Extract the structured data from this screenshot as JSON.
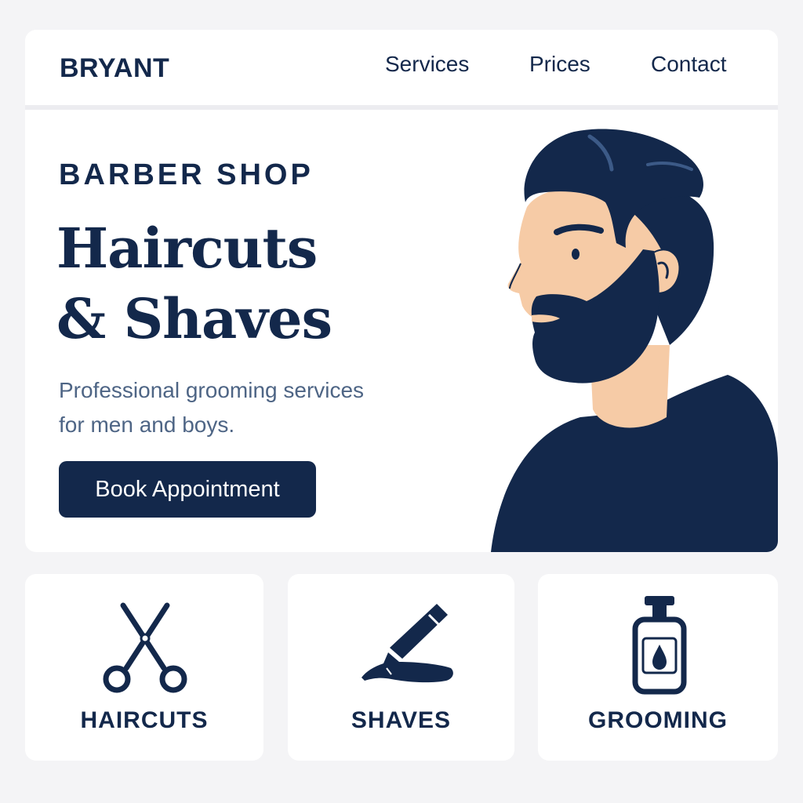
{
  "header": {
    "brand": "BRYANT",
    "nav": [
      {
        "label": "Services"
      },
      {
        "label": "Prices"
      },
      {
        "label": "Contact"
      }
    ]
  },
  "hero": {
    "eyebrow": "BARBER SHOP",
    "headline": [
      "Haircuts",
      "& Shaves"
    ],
    "subtitle": [
      "Professional grooming services",
      "for men and boys."
    ],
    "cta_label": "Book Appointment",
    "illustration": "bearded-man-profile-illustration"
  },
  "services": [
    {
      "label": "HAIRCUTS",
      "icon": "scissors-icon"
    },
    {
      "label": "SHAVES",
      "icon": "straight-razor-icon"
    },
    {
      "label": "GROOMING",
      "icon": "pump-bottle-icon"
    }
  ],
  "colors": {
    "navy": "#13284b",
    "muted_text": "#4e6585",
    "skin": "#f6cba6",
    "background": "#f4f4f6",
    "card": "#ffffff"
  }
}
